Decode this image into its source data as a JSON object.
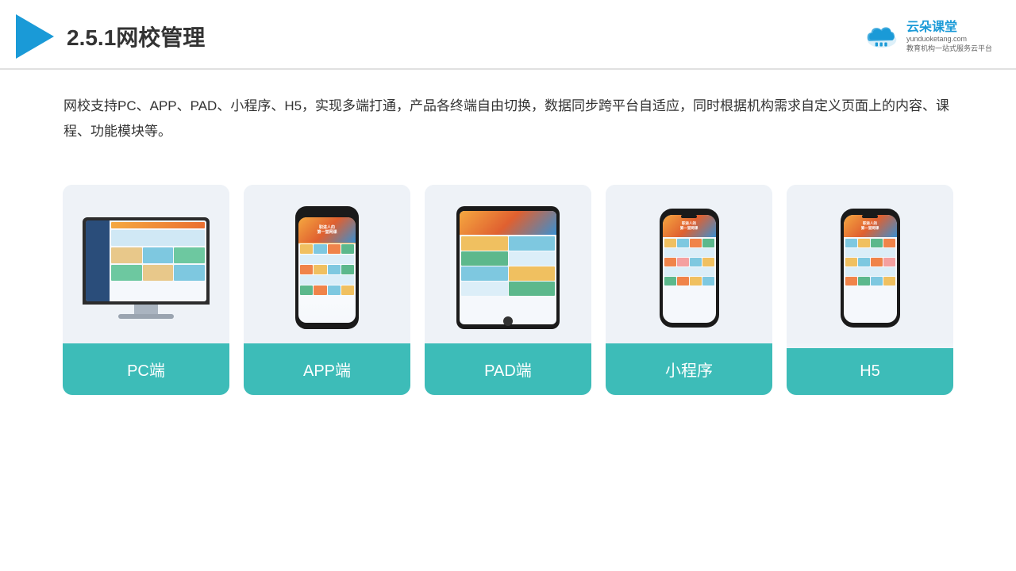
{
  "header": {
    "title": "2.5.1网校管理",
    "brand_name": "云朵课堂",
    "brand_sub_line1": "教育机构一站",
    "brand_sub_line2": "式服务云平台",
    "brand_url": "yunduoketang.com"
  },
  "description": {
    "text": "网校支持PC、APP、PAD、小程序、H5，实现多端打通，产品各终端自由切换，数据同步跨平台自适应，同时根据机构需求自定义页面上的内容、课程、功能模块等。"
  },
  "cards": [
    {
      "id": "pc",
      "label": "PC端"
    },
    {
      "id": "app",
      "label": "APP端"
    },
    {
      "id": "pad",
      "label": "PAD端"
    },
    {
      "id": "miniprogram",
      "label": "小程序"
    },
    {
      "id": "h5",
      "label": "H5"
    }
  ],
  "colors": {
    "teal": "#3dbcb8",
    "blue": "#1a9ad7",
    "header_border": "#e0e0e0"
  }
}
